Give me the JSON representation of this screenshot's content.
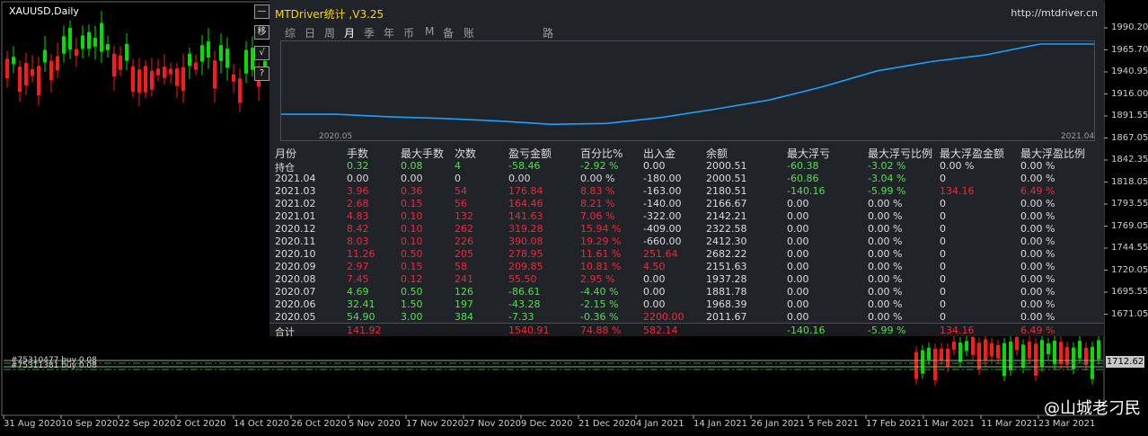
{
  "chart": {
    "symbol": "XAUUSD,Daily",
    "side_buttons": [
      "—",
      "移",
      "√",
      "?"
    ],
    "price_labels": [
      "1990.20",
      "1965.70",
      "1940.95",
      "1916.00",
      "1891.55",
      "1867.05",
      "1842.35",
      "1818.05",
      "1793.55",
      "1769.05",
      "1744.55",
      "1720.05",
      "1695.55",
      "1671.05"
    ],
    "current_price": "1712.62",
    "date_labels": [
      "31 Aug 2020",
      "10 Sep 2020",
      "22 Sep 2020",
      "2 Oct 2020",
      "14 Oct 2020",
      "26 Oct 2020",
      "5 Nov 2020",
      "17 Nov 2020",
      "27 Nov 2020",
      "9 Dec 2020",
      "21 Dec 2020",
      "4 Jan 2021",
      "14 Jan 2021",
      "26 Jan 2021",
      "5 Feb 2021",
      "17 Feb 2021",
      "1 Mar 2021",
      "11 Mar 2021",
      "23 Mar 2021"
    ],
    "order_labels": [
      "#75310477 buy 0.08",
      "#75311381 buy 0.08"
    ],
    "watermark": "@山城老刁民",
    "colors": {
      "bull": "#00e000",
      "bear": "#ff1a1a",
      "grid_line": "#30a030"
    }
  },
  "panel": {
    "title": "MTDriver统计 ,V3.25",
    "url": "http://mtdriver.cn",
    "tabs": [
      {
        "label": "综",
        "active": false
      },
      {
        "label": "日",
        "active": false
      },
      {
        "label": "周",
        "active": false
      },
      {
        "label": "月",
        "active": true
      },
      {
        "label": "季",
        "active": false
      },
      {
        "label": "年",
        "active": false
      },
      {
        "label": "币",
        "active": false
      },
      {
        "label": "M",
        "active": false
      },
      {
        "label": "备",
        "active": false
      },
      {
        "label": "账户",
        "active": false
      },
      {
        "label": "路径",
        "active": false
      }
    ],
    "equity_start_label": "2020.05",
    "equity_end_label": "2021.04",
    "equity_curve": [
      0.16,
      0.16,
      0.13,
      0.11,
      0.08,
      0.04,
      0.05,
      0.12,
      0.22,
      0.33,
      0.49,
      0.68,
      0.79,
      0.87,
      1.0,
      1.0
    ],
    "equity_color": "#1ea0ff",
    "columns": [
      "月份",
      "手数",
      "最大手数",
      "次数",
      "盈亏金额",
      "百分比%",
      "出入金",
      "余额",
      "最大浮亏",
      "最大浮亏比例",
      "最大浮盈金额",
      "最大浮盈比例"
    ],
    "rows": [
      {
        "cells": [
          "持仓",
          "0.32",
          "0.08",
          "4",
          "-58.46",
          "-2.92 %",
          "0.00",
          "2000.51",
          "-60.38",
          "-3.02 %",
          "0.00 %",
          "0.00 %"
        ],
        "tone": "pos-hold"
      },
      {
        "cells": [
          "2021.04",
          "0.00",
          "0.00",
          "0",
          "0.00",
          "0.00 %",
          "-180.00",
          "2000.51",
          "-60.86",
          "-3.04 %",
          "0",
          "0.00 %"
        ],
        "tone": "neutral"
      },
      {
        "cells": [
          "2021.03",
          "3.96",
          "0.36",
          "54",
          "176.84",
          "8.83 %",
          "-163.00",
          "2180.51",
          "-140.16",
          "-5.99 %",
          "134.16",
          "6.49 %"
        ],
        "tone": "red"
      },
      {
        "cells": [
          "2021.02",
          "2.68",
          "0.15",
          "56",
          "164.46",
          "8.21 %",
          "-140.00",
          "2166.67",
          "0.00",
          "0.00 %",
          "0",
          "0.00 %"
        ],
        "tone": "red"
      },
      {
        "cells": [
          "2021.01",
          "4.83",
          "0.10",
          "132",
          "141.63",
          "7.06 %",
          "-322.00",
          "2142.21",
          "0.00",
          "0.00 %",
          "0",
          "0.00 %"
        ],
        "tone": "red"
      },
      {
        "cells": [
          "2020.12",
          "8.42",
          "0.10",
          "262",
          "319.28",
          "15.94 %",
          "-409.00",
          "2322.58",
          "0.00",
          "0.00 %",
          "0",
          "0.00 %"
        ],
        "tone": "red"
      },
      {
        "cells": [
          "2020.11",
          "8.03",
          "0.10",
          "226",
          "390.08",
          "19.29 %",
          "-660.00",
          "2412.30",
          "0.00",
          "0.00 %",
          "0",
          "0.00 %"
        ],
        "tone": "red"
      },
      {
        "cells": [
          "2020.10",
          "11.26",
          "0.50",
          "205",
          "278.95",
          "11.61 %",
          "251.64",
          "2682.22",
          "0.00",
          "0.00 %",
          "0",
          "0.00 %"
        ],
        "tone": "red-in"
      },
      {
        "cells": [
          "2020.09",
          "2.97",
          "0.15",
          "58",
          "209.85",
          "10.81 %",
          "4.50",
          "2151.63",
          "0.00",
          "0.00 %",
          "0",
          "0.00 %"
        ],
        "tone": "red-in"
      },
      {
        "cells": [
          "2020.08",
          "7.45",
          "0.12",
          "241",
          "55.50",
          "2.95 %",
          "0.00",
          "1937.28",
          "0.00",
          "0.00 %",
          "0",
          "0.00 %"
        ],
        "tone": "red"
      },
      {
        "cells": [
          "2020.07",
          "4.69",
          "0.50",
          "126",
          "-86.61",
          "-4.40 %",
          "0.00",
          "1881.78",
          "0.00",
          "0.00 %",
          "0",
          "0.00 %"
        ],
        "tone": "green"
      },
      {
        "cells": [
          "2020.06",
          "32.41",
          "1.50",
          "197",
          "-43.28",
          "-2.15 %",
          "0.00",
          "1968.39",
          "0.00",
          "0.00 %",
          "0",
          "0.00 %"
        ],
        "tone": "green"
      },
      {
        "cells": [
          "2020.05",
          "54.90",
          "3.00",
          "384",
          "-7.33",
          "-0.36 %",
          "2200.00",
          "2011.67",
          "0.00",
          "0.00 %",
          "0",
          "0.00 %"
        ],
        "tone": "green-in"
      }
    ],
    "total": {
      "label": "合计",
      "lots": "141.92",
      "profit": "1540.91",
      "percent": "74.88 %",
      "deposit": "582.14",
      "max_dd": "-140.16",
      "max_dd_pct": "-5.99 %",
      "max_fp": "134.16",
      "max_fp_pct": "6.49 %"
    }
  }
}
